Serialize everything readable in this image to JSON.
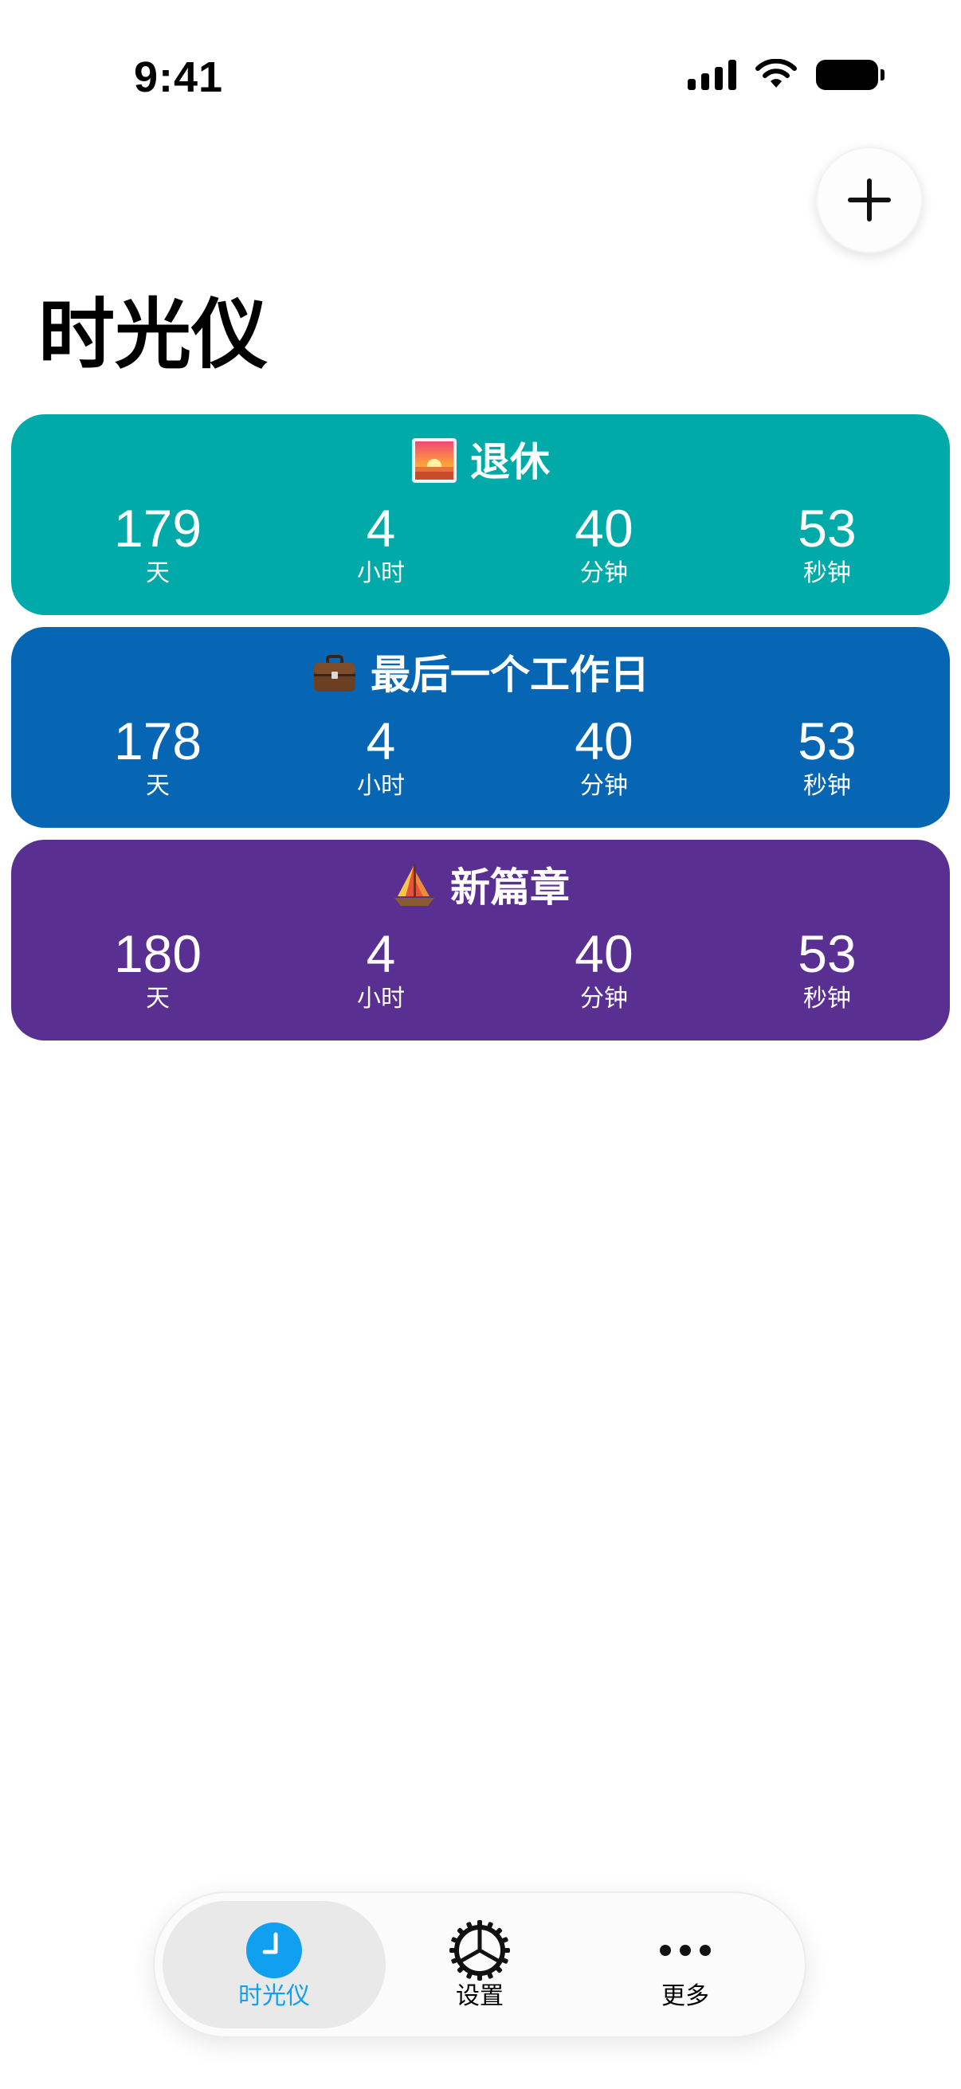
{
  "status_bar": {
    "time": "9:41"
  },
  "add_button": {
    "icon": "plus-icon"
  },
  "page": {
    "title": "时光仪"
  },
  "cards": [
    {
      "title": "退休",
      "icon": "sunrise-icon",
      "color": "#00AAA8",
      "days": "179",
      "days_unit": "天",
      "hours": "4",
      "hours_unit": "小时",
      "minutes": "40",
      "minutes_unit": "分钟",
      "seconds": "53",
      "seconds_unit": "秒钟"
    },
    {
      "title": "最后一个工作日",
      "icon": "briefcase-icon",
      "color": "#0766B3",
      "days": "178",
      "days_unit": "天",
      "hours": "4",
      "hours_unit": "小时",
      "minutes": "40",
      "minutes_unit": "分钟",
      "seconds": "53",
      "seconds_unit": "秒钟"
    },
    {
      "title": "新篇章",
      "icon": "sailboat-icon",
      "color": "#5A2F92",
      "days": "180",
      "days_unit": "天",
      "hours": "4",
      "hours_unit": "小时",
      "minutes": "40",
      "minutes_unit": "分钟",
      "seconds": "53",
      "seconds_unit": "秒钟"
    }
  ],
  "tab_bar": {
    "active_color": "#11A0F0",
    "tabs": [
      {
        "label": "时光仪",
        "icon": "clock-icon",
        "active": true
      },
      {
        "label": "设置",
        "icon": "gear-icon",
        "active": false
      },
      {
        "label": "更多",
        "icon": "more-icon",
        "active": false
      }
    ]
  }
}
